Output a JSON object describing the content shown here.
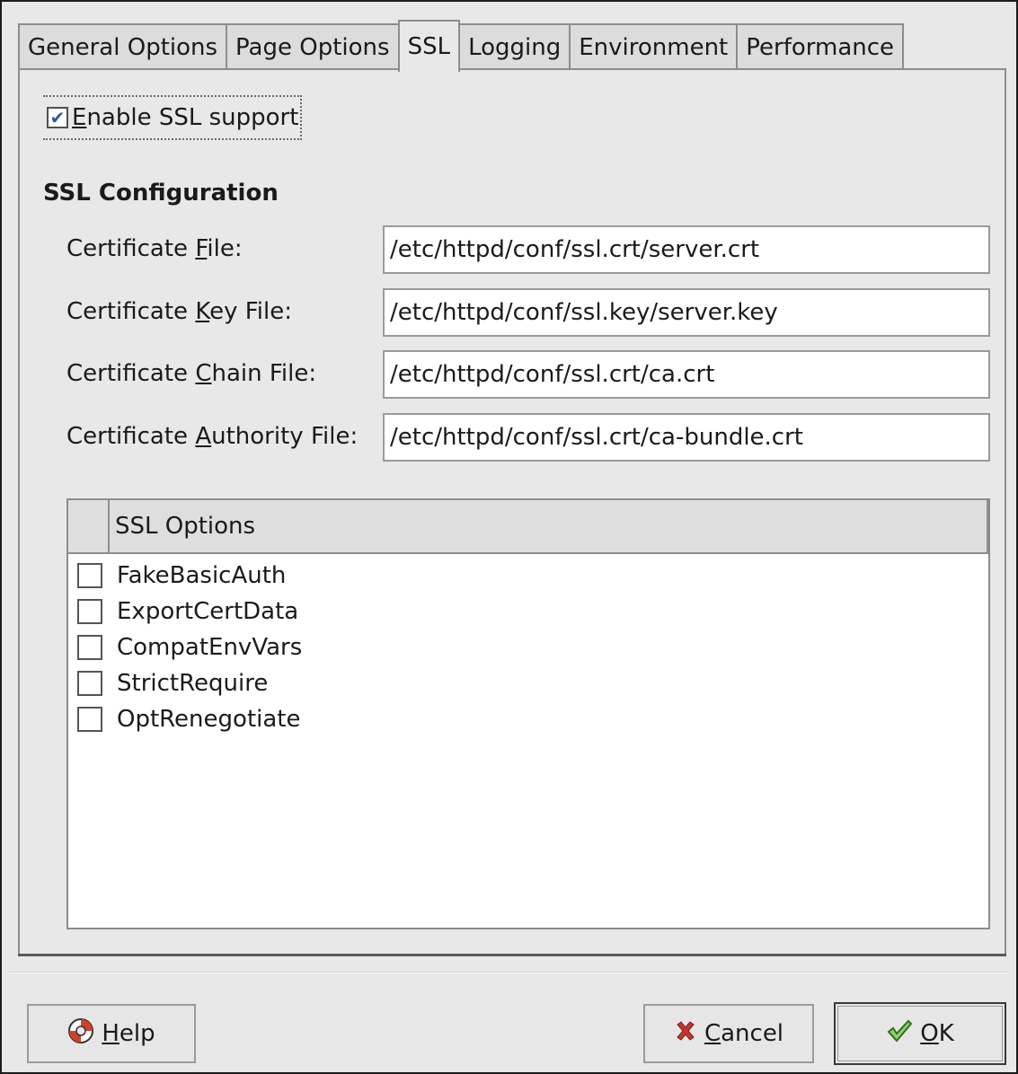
{
  "tabs": [
    {
      "label": "General Options"
    },
    {
      "label": "Page Options"
    },
    {
      "label": "SSL"
    },
    {
      "label": "Logging"
    },
    {
      "label": "Environment"
    },
    {
      "label": "Performance"
    }
  ],
  "active_tab": "SSL",
  "enable_ssl": {
    "checked": true,
    "mnemonic": "E",
    "label_rest": "nable SSL support"
  },
  "section_title": "SSL Configuration",
  "fields": [
    {
      "pre": "Certificate ",
      "mn": "F",
      "post": "ile:",
      "value": "/etc/httpd/conf/ssl.crt/server.crt"
    },
    {
      "pre": "Certificate ",
      "mn": "K",
      "post": "ey File:",
      "value": "/etc/httpd/conf/ssl.key/server.key"
    },
    {
      "pre": "Certificate ",
      "mn": "C",
      "post": "hain File:",
      "value": "/etc/httpd/conf/ssl.crt/ca.crt"
    },
    {
      "pre": "Certificate ",
      "mn": "A",
      "post": "uthority File:",
      "value": "/etc/httpd/conf/ssl.crt/ca-bundle.crt"
    }
  ],
  "options_list": {
    "header": "SSL Options",
    "items": [
      {
        "label": "FakeBasicAuth",
        "checked": false
      },
      {
        "label": "ExportCertData",
        "checked": false
      },
      {
        "label": "CompatEnvVars",
        "checked": false
      },
      {
        "label": "StrictRequire",
        "checked": false
      },
      {
        "label": "OptRenegotiate",
        "checked": false
      }
    ]
  },
  "buttons": {
    "help": {
      "mn": "H",
      "rest": "elp",
      "icon": "lifebuoy-icon"
    },
    "cancel": {
      "mn": "C",
      "rest": "ancel",
      "icon": "x-mark-icon"
    },
    "ok": {
      "mn": "O",
      "rest": "K",
      "icon": "checkmark-icon"
    }
  },
  "colors": {
    "check": "#2c5aa0",
    "cancel_icon": "#c0392b",
    "ok_icon": "#3a8a2e",
    "help_icon": "#d0402a"
  }
}
